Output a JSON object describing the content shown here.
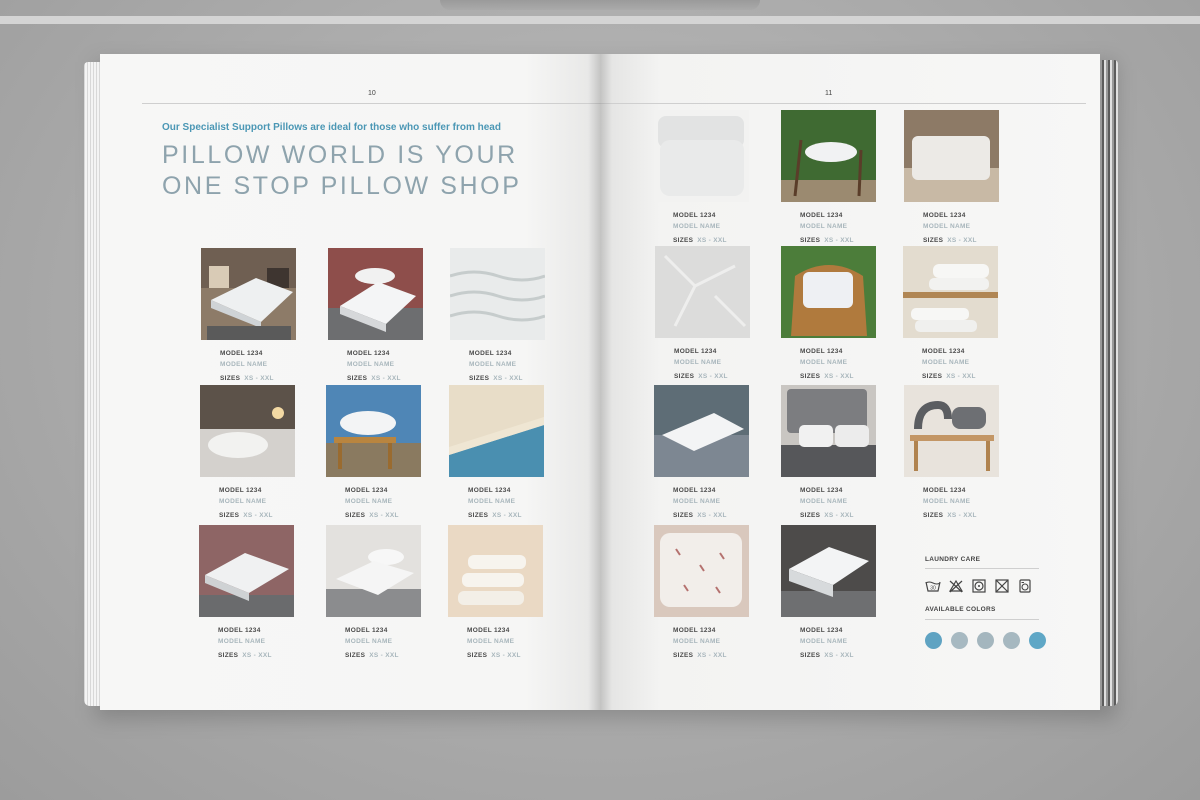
{
  "spread": {
    "left_page": {
      "page_number": "10",
      "intro": "Our Specialist Support Pillows are ideal for those who suffer from head",
      "headline_line1": "PILLOW WORLD IS YOUR",
      "headline_line2": "ONE STOP PILLOW SHOP",
      "products": [
        {
          "model": "MODEL 1234",
          "name": "MODEL NAME",
          "sizes_label": "SIZES",
          "sizes_value": "XS - XXL"
        },
        {
          "model": "MODEL 1234",
          "name": "MODEL NAME",
          "sizes_label": "SIZES",
          "sizes_value": "XS - XXL"
        },
        {
          "model": "MODEL 1234",
          "name": "MODEL NAME",
          "sizes_label": "SIZES",
          "sizes_value": "XS - XXL"
        },
        {
          "model": "MODEL 1234",
          "name": "MODEL NAME",
          "sizes_label": "SIZES",
          "sizes_value": "XS - XXL"
        },
        {
          "model": "MODEL 1234",
          "name": "MODEL NAME",
          "sizes_label": "SIZES",
          "sizes_value": "XS - XXL"
        },
        {
          "model": "MODEL 1234",
          "name": "MODEL NAME",
          "sizes_label": "SIZES",
          "sizes_value": "XS - XXL"
        },
        {
          "model": "MODEL 1234",
          "name": "MODEL NAME",
          "sizes_label": "SIZES",
          "sizes_value": "XS - XXL"
        },
        {
          "model": "MODEL 1234",
          "name": "MODEL NAME",
          "sizes_label": "SIZES",
          "sizes_value": "XS - XXL"
        },
        {
          "model": "MODEL 1234",
          "name": "MODEL NAME",
          "sizes_label": "SIZES",
          "sizes_value": "XS - XXL"
        }
      ]
    },
    "right_page": {
      "page_number": "11",
      "products": [
        {
          "model": "MODEL 1234",
          "name": "MODEL NAME",
          "sizes_label": "SIZES",
          "sizes_value": "XS - XXL"
        },
        {
          "model": "MODEL 1234",
          "name": "MODEL NAME",
          "sizes_label": "SIZES",
          "sizes_value": "XS - XXL"
        },
        {
          "model": "MODEL 1234",
          "name": "MODEL NAME",
          "sizes_label": "SIZES",
          "sizes_value": "XS - XXL"
        },
        {
          "model": "MODEL 1234",
          "name": "MODEL NAME",
          "sizes_label": "SIZES",
          "sizes_value": "XS - XXL"
        },
        {
          "model": "MODEL 1234",
          "name": "MODEL NAME",
          "sizes_label": "SIZES",
          "sizes_value": "XS - XXL"
        },
        {
          "model": "MODEL 1234",
          "name": "MODEL NAME",
          "sizes_label": "SIZES",
          "sizes_value": "XS - XXL"
        },
        {
          "model": "MODEL 1234",
          "name": "MODEL NAME",
          "sizes_label": "SIZES",
          "sizes_value": "XS - XXL"
        },
        {
          "model": "MODEL 1234",
          "name": "MODEL NAME",
          "sizes_label": "SIZES",
          "sizes_value": "XS - XXL"
        },
        {
          "model": "MODEL 1234",
          "name": "MODEL NAME",
          "sizes_label": "SIZES",
          "sizes_value": "XS - XXL"
        },
        {
          "model": "MODEL 1234",
          "name": "MODEL NAME",
          "sizes_label": "SIZES",
          "sizes_value": "XS - XXL"
        },
        {
          "model": "MODEL 1234",
          "name": "MODEL NAME",
          "sizes_label": "SIZES",
          "sizes_value": "XS - XXL"
        }
      ],
      "laundry_care_title": "LAUNDRY CARE",
      "laundry_icons": [
        "wash-30-icon",
        "no-bleach-icon",
        "tumble-dry-icon",
        "no-dry-clean-icon",
        "washing-machine-icon"
      ],
      "available_colors_title": "AVAILABLE COLORS",
      "colors": [
        "#5fa3c2",
        "#a7b9c1",
        "#a4b6be",
        "#a6b8c0",
        "#5fa7c6"
      ]
    }
  },
  "theme": {
    "accent": "#4b97b5",
    "headline": "#8ea3ad",
    "muted_text": "#a8b6bc"
  }
}
